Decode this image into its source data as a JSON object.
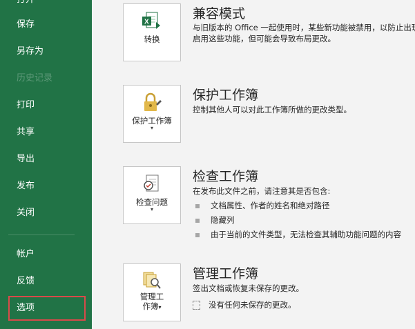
{
  "sidebar": {
    "items": [
      {
        "label": "打开"
      },
      {
        "label": "保存"
      },
      {
        "label": "另存为"
      },
      {
        "label": "历史记录"
      },
      {
        "label": "打印"
      },
      {
        "label": "共享"
      },
      {
        "label": "导出"
      },
      {
        "label": "发布"
      },
      {
        "label": "关闭"
      },
      {
        "label": "帐户"
      },
      {
        "label": "反馈"
      },
      {
        "label": "选项"
      }
    ]
  },
  "sections": [
    {
      "title": "兼容模式",
      "button": {
        "label": "转换",
        "icon": "excel-convert-icon"
      },
      "description": [
        "与旧版本的 Office 一起使用时，某些新功能被禁用，以防止出现",
        "启用这些功能，但可能会导致布局更改。"
      ]
    },
    {
      "title": "保护工作簿",
      "button": {
        "label": "保护工作簿",
        "caret": "▾",
        "icon": "lock-key-icon"
      },
      "description": [
        "控制其他人可以对此工作簿所做的更改类型。"
      ]
    },
    {
      "title": "检查工作簿",
      "button": {
        "label": "检查问题",
        "caret": "▾",
        "icon": "inspect-document-icon"
      },
      "description": [
        "在发布此文件之前，请注意其是否包含:"
      ],
      "bullets": [
        "文档属性、作者的姓名和绝对路径",
        "隐藏列",
        "由于当前的文件类型，无法检查其辅助功能问题的内容"
      ]
    },
    {
      "title": "管理工作簿",
      "button": {
        "label_line1": "管理工",
        "label_line2": "作簿",
        "caret": "▾",
        "icon": "manage-workbook-icon"
      },
      "description": [
        "签出文档或恢复未保存的更改。"
      ],
      "status": "没有任何未保存的更改。"
    }
  ],
  "colors": {
    "sidebar_bg": "#217346",
    "selected_outline": "#d94a4a",
    "excel_green": "#217346"
  }
}
